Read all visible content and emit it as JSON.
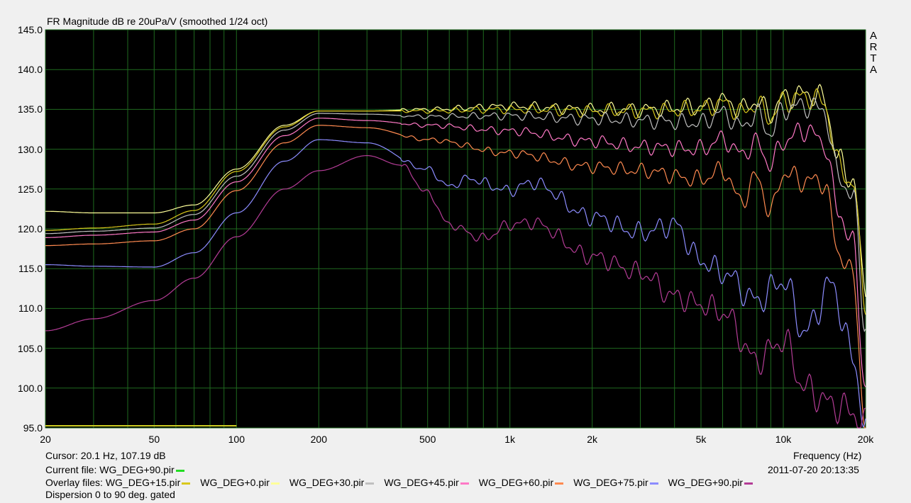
{
  "chart_data": {
    "type": "line",
    "title": "FR Magnitude dB re 20uPa/V (smoothed 1/24 oct)",
    "xlabel": "Frequency (Hz)",
    "xscale": "log",
    "xlim": [
      20,
      20000
    ],
    "ylim": [
      95,
      145
    ],
    "xticks": [
      "20",
      "50",
      "100",
      "200",
      "500",
      "1k",
      "2k",
      "5k",
      "10k",
      "20k"
    ],
    "xtick_values": [
      20,
      50,
      100,
      200,
      500,
      1000,
      2000,
      5000,
      10000,
      20000
    ],
    "yticks": [
      "145.0",
      "140.0",
      "135.0",
      "130.0",
      "125.0",
      "120.0",
      "115.0",
      "110.0",
      "105.0",
      "100.0",
      "95.0"
    ],
    "ytick_values": [
      145,
      140,
      135,
      130,
      125,
      120,
      115,
      110,
      105,
      100,
      95
    ],
    "grid": true,
    "background": "#000000",
    "grid_color": "#1f6a1f",
    "watermark": [
      "A",
      "R",
      "T",
      "A"
    ],
    "series": [
      {
        "name": "WG_DEG+0.pir",
        "color": "#ffff99",
        "x": [
          20,
          30,
          50,
          70,
          100,
          150,
          200,
          300,
          500,
          1000,
          2000,
          3000,
          5000,
          6000,
          7000,
          8000,
          9000,
          10000,
          12000,
          14000,
          16000,
          18000,
          20000
        ],
        "y": [
          122.2,
          122.0,
          122.0,
          123.0,
          127.5,
          133.0,
          134.8,
          134.8,
          135.0,
          135.4,
          135.0,
          135.0,
          135.3,
          136.2,
          135.0,
          136.0,
          134.5,
          136.5,
          137.0,
          136.5,
          128.5,
          126.0,
          112.0
        ]
      },
      {
        "name": "WG_DEG+15.pir",
        "color": "#d9c81c",
        "x": [
          20,
          30,
          50,
          70,
          100,
          150,
          200,
          300,
          500,
          1000,
          2000,
          3000,
          5000,
          6000,
          7000,
          8000,
          9000,
          10000,
          12000,
          14000,
          16000,
          18000,
          20000
        ],
        "y": [
          119.8,
          120.1,
          120.6,
          122.3,
          127.2,
          132.8,
          134.8,
          134.8,
          134.8,
          135.0,
          134.8,
          134.8,
          135.0,
          135.8,
          134.6,
          135.6,
          134.0,
          136.0,
          136.6,
          136.0,
          128.0,
          125.5,
          111.0
        ]
      },
      {
        "name": "WG_DEG+30.pir",
        "color": "#c0c0c0",
        "x": [
          20,
          30,
          50,
          70,
          100,
          150,
          200,
          300,
          500,
          1000,
          2000,
          3000,
          5000,
          6000,
          7000,
          8000,
          9000,
          10000,
          12000,
          14000,
          16000,
          18000,
          20000
        ],
        "y": [
          119.4,
          119.7,
          120.1,
          121.8,
          126.6,
          132.4,
          134.5,
          134.4,
          134.1,
          134.2,
          133.8,
          133.6,
          133.3,
          134.6,
          132.8,
          134.4,
          132.0,
          135.0,
          135.5,
          135.0,
          126.5,
          124.0,
          108.0
        ]
      },
      {
        "name": "WG_DEG+45.pir",
        "color": "#ff79c6",
        "x": [
          20,
          30,
          50,
          70,
          100,
          150,
          200,
          300,
          500,
          1000,
          2000,
          3000,
          5000,
          6000,
          7000,
          8000,
          9000,
          10000,
          12000,
          14000,
          16000,
          18000,
          20000
        ],
        "y": [
          118.9,
          119.2,
          119.6,
          121.1,
          125.9,
          131.7,
          133.9,
          133.6,
          133.0,
          132.3,
          131.0,
          130.3,
          130.0,
          131.3,
          129.4,
          130.8,
          128.0,
          131.0,
          132.5,
          131.0,
          122.0,
          118.0,
          100.0
        ]
      },
      {
        "name": "WG_DEG+60.pir",
        "color": "#ff8a50",
        "x": [
          20,
          30,
          50,
          70,
          100,
          150,
          200,
          300,
          500,
          1000,
          2000,
          3000,
          5000,
          6000,
          7000,
          8000,
          9000,
          10000,
          12000,
          14000,
          16000,
          18000,
          20000
        ],
        "y": [
          117.9,
          118.1,
          118.5,
          120.0,
          124.8,
          130.8,
          133.0,
          132.7,
          131.2,
          129.5,
          127.8,
          127.3,
          126.2,
          127.4,
          123.5,
          126.5,
          122.0,
          127.0,
          126.0,
          126.0,
          117.0,
          114.0,
          95.0
        ]
      },
      {
        "name": "WG_DEG+75.pir",
        "color": "#8c8cff",
        "x": [
          20,
          30,
          50,
          70,
          100,
          150,
          200,
          300,
          500,
          600,
          700,
          1000,
          1200,
          2000,
          3000,
          4000,
          5000,
          6000,
          8000,
          10000,
          12000,
          15000,
          18000,
          20000
        ],
        "y": [
          115.5,
          115.3,
          115.2,
          117.0,
          122.0,
          128.5,
          131.2,
          130.8,
          127.5,
          125.3,
          126.3,
          124.8,
          125.8,
          121.5,
          119.5,
          120.5,
          116.0,
          114.5,
          111.0,
          113.5,
          107.0,
          113.0,
          104.0,
          95.0
        ]
      },
      {
        "name": "WG_DEG+90.pir",
        "color": "#b43c96",
        "x": [
          20,
          30,
          50,
          70,
          100,
          150,
          200,
          300,
          400,
          500,
          600,
          800,
          1000,
          1200,
          2000,
          3000,
          4000,
          5000,
          6000,
          8000,
          10000,
          12000,
          15000,
          18000,
          20000
        ],
        "y": [
          107.2,
          108.7,
          111.0,
          113.8,
          119.0,
          125.0,
          127.3,
          129.2,
          128.0,
          124.5,
          120.5,
          118.8,
          120.5,
          120.8,
          116.5,
          114.5,
          111.5,
          110.5,
          109.5,
          103.5,
          106.0,
          100.0,
          98.0,
          97.0,
          95.0
        ]
      }
    ]
  },
  "footer": {
    "cursor": "Cursor: 20.1 Hz, 107.19 dB",
    "current_file_label": "Current file: WG_DEG+90.pir",
    "current_file_color": "#22dd22",
    "overlay_label": "Overlay files:",
    "overlay_items": [
      {
        "label": "WG_DEG+15.pir",
        "color": "#d9c81c"
      },
      {
        "label": "WG_DEG+0.pir",
        "color": "#ffff99"
      },
      {
        "label": "WG_DEG+30.pir",
        "color": "#c0c0c0"
      },
      {
        "label": "WG_DEG+45.pir",
        "color": "#ff79c6"
      },
      {
        "label": "WG_DEG+60.pir",
        "color": "#ff8a50"
      },
      {
        "label": "WG_DEG+75.pir",
        "color": "#8c8cff"
      },
      {
        "label": "WG_DEG+90.pir",
        "color": "#b43c96"
      }
    ],
    "dispersion": "Dispersion 0 to 90 deg. gated",
    "date": "2011-07-20  20:13:35"
  },
  "colors": {
    "bottom_marker": "#cccc22"
  }
}
